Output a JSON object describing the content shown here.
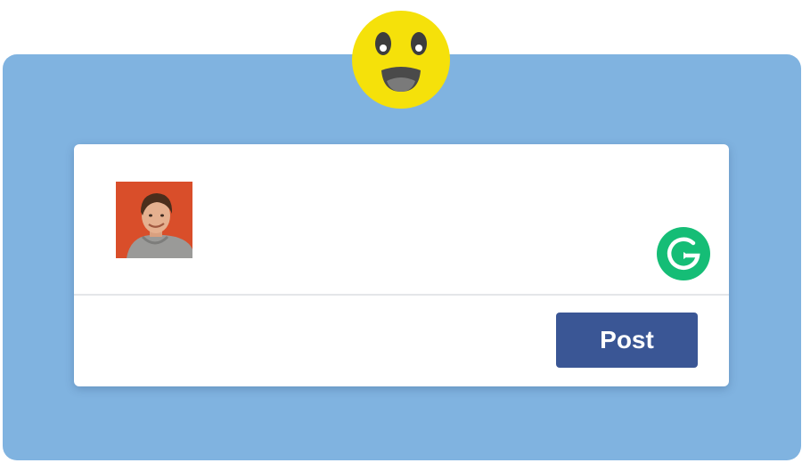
{
  "composer": {
    "text": "",
    "post_label": "Post"
  },
  "avatar": {
    "background_color": "#d94e2a",
    "shirt_color": "#9a9a98"
  },
  "reaction": {
    "icon": "surprised-face-icon",
    "color": "#f5e10a"
  },
  "grammarly": {
    "icon": "grammarly-icon",
    "color": "#15bd76"
  },
  "theme": {
    "panel_color": "#80b3e0",
    "button_color": "#3a5695"
  }
}
